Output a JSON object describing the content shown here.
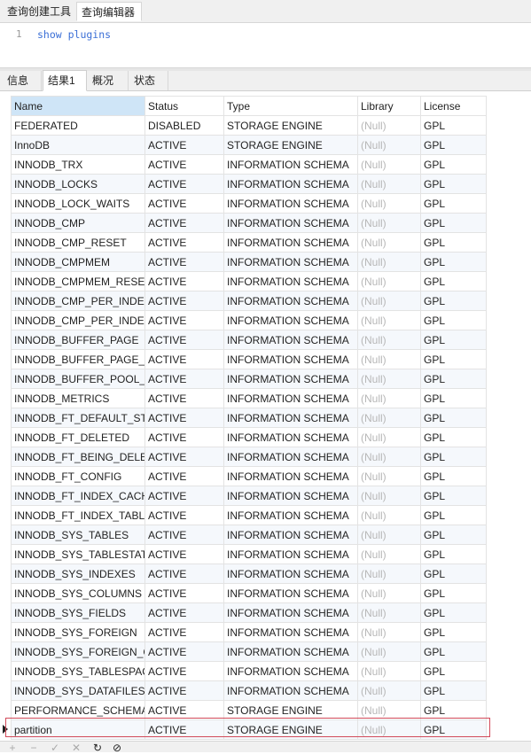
{
  "top_tabs": [
    "查询创建工具",
    "查询编辑器"
  ],
  "editor": {
    "line_number": "1",
    "code": "show plugins"
  },
  "result_tabs": [
    "信息",
    "结果1",
    "概况",
    "状态"
  ],
  "columns": [
    "Name",
    "Status",
    "Type",
    "Library",
    "License"
  ],
  "rows": [
    [
      "FEDERATED",
      "DISABLED",
      "STORAGE ENGINE",
      "(Null)",
      "GPL"
    ],
    [
      "InnoDB",
      "ACTIVE",
      "STORAGE ENGINE",
      "(Null)",
      "GPL"
    ],
    [
      "INNODB_TRX",
      "ACTIVE",
      "INFORMATION SCHEMA",
      "(Null)",
      "GPL"
    ],
    [
      "INNODB_LOCKS",
      "ACTIVE",
      "INFORMATION SCHEMA",
      "(Null)",
      "GPL"
    ],
    [
      "INNODB_LOCK_WAITS",
      "ACTIVE",
      "INFORMATION SCHEMA",
      "(Null)",
      "GPL"
    ],
    [
      "INNODB_CMP",
      "ACTIVE",
      "INFORMATION SCHEMA",
      "(Null)",
      "GPL"
    ],
    [
      "INNODB_CMP_RESET",
      "ACTIVE",
      "INFORMATION SCHEMA",
      "(Null)",
      "GPL"
    ],
    [
      "INNODB_CMPMEM",
      "ACTIVE",
      "INFORMATION SCHEMA",
      "(Null)",
      "GPL"
    ],
    [
      "INNODB_CMPMEM_RESE",
      "ACTIVE",
      "INFORMATION SCHEMA",
      "(Null)",
      "GPL"
    ],
    [
      "INNODB_CMP_PER_INDEX",
      "ACTIVE",
      "INFORMATION SCHEMA",
      "(Null)",
      "GPL"
    ],
    [
      "INNODB_CMP_PER_INDEX",
      "ACTIVE",
      "INFORMATION SCHEMA",
      "(Null)",
      "GPL"
    ],
    [
      "INNODB_BUFFER_PAGE",
      "ACTIVE",
      "INFORMATION SCHEMA",
      "(Null)",
      "GPL"
    ],
    [
      "INNODB_BUFFER_PAGE_L",
      "ACTIVE",
      "INFORMATION SCHEMA",
      "(Null)",
      "GPL"
    ],
    [
      "INNODB_BUFFER_POOL_S",
      "ACTIVE",
      "INFORMATION SCHEMA",
      "(Null)",
      "GPL"
    ],
    [
      "INNODB_METRICS",
      "ACTIVE",
      "INFORMATION SCHEMA",
      "(Null)",
      "GPL"
    ],
    [
      "INNODB_FT_DEFAULT_STO",
      "ACTIVE",
      "INFORMATION SCHEMA",
      "(Null)",
      "GPL"
    ],
    [
      "INNODB_FT_DELETED",
      "ACTIVE",
      "INFORMATION SCHEMA",
      "(Null)",
      "GPL"
    ],
    [
      "INNODB_FT_BEING_DELET",
      "ACTIVE",
      "INFORMATION SCHEMA",
      "(Null)",
      "GPL"
    ],
    [
      "INNODB_FT_CONFIG",
      "ACTIVE",
      "INFORMATION SCHEMA",
      "(Null)",
      "GPL"
    ],
    [
      "INNODB_FT_INDEX_CACH",
      "ACTIVE",
      "INFORMATION SCHEMA",
      "(Null)",
      "GPL"
    ],
    [
      "INNODB_FT_INDEX_TABL",
      "ACTIVE",
      "INFORMATION SCHEMA",
      "(Null)",
      "GPL"
    ],
    [
      "INNODB_SYS_TABLES",
      "ACTIVE",
      "INFORMATION SCHEMA",
      "(Null)",
      "GPL"
    ],
    [
      "INNODB_SYS_TABLESTAT",
      "ACTIVE",
      "INFORMATION SCHEMA",
      "(Null)",
      "GPL"
    ],
    [
      "INNODB_SYS_INDEXES",
      "ACTIVE",
      "INFORMATION SCHEMA",
      "(Null)",
      "GPL"
    ],
    [
      "INNODB_SYS_COLUMNS",
      "ACTIVE",
      "INFORMATION SCHEMA",
      "(Null)",
      "GPL"
    ],
    [
      "INNODB_SYS_FIELDS",
      "ACTIVE",
      "INFORMATION SCHEMA",
      "(Null)",
      "GPL"
    ],
    [
      "INNODB_SYS_FOREIGN",
      "ACTIVE",
      "INFORMATION SCHEMA",
      "(Null)",
      "GPL"
    ],
    [
      "INNODB_SYS_FOREIGN_C",
      "ACTIVE",
      "INFORMATION SCHEMA",
      "(Null)",
      "GPL"
    ],
    [
      "INNODB_SYS_TABLESPAC",
      "ACTIVE",
      "INFORMATION SCHEMA",
      "(Null)",
      "GPL"
    ],
    [
      "INNODB_SYS_DATAFILES",
      "ACTIVE",
      "INFORMATION SCHEMA",
      "(Null)",
      "GPL"
    ],
    [
      "PERFORMANCE_SCHEMA",
      "ACTIVE",
      "STORAGE ENGINE",
      "(Null)",
      "GPL"
    ],
    [
      "partition",
      "ACTIVE",
      "STORAGE ENGINE",
      "(Null)",
      "GPL"
    ]
  ],
  "selected_row": 31,
  "toolbar_icons": [
    "add-record-icon",
    "delete-record-icon",
    "apply-icon",
    "discard-icon",
    "refresh-icon",
    "stop-icon"
  ],
  "colors": {
    "null_text": "#b7b7b7",
    "selection_border": "#d24a5a",
    "sorted_header": "#cfe5f7"
  }
}
